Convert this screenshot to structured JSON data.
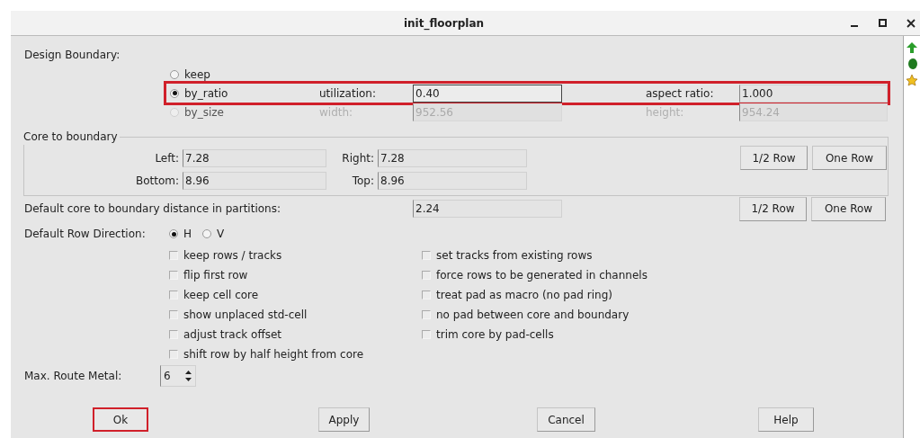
{
  "window": {
    "title": "init_floorplan"
  },
  "design_boundary": {
    "label": "Design Boundary:",
    "options": [
      {
        "label": "keep",
        "selected": false,
        "disabled": false,
        "highlighted": false
      },
      {
        "label": "by_ratio",
        "selected": true,
        "disabled": false,
        "highlighted": true,
        "fields": [
          {
            "label": "utilization:",
            "value": "0.40",
            "focused": true
          },
          {
            "label": "aspect ratio:",
            "value": "1.000",
            "focused": false
          }
        ]
      },
      {
        "label": "by_size",
        "selected": false,
        "disabled": true,
        "highlighted": false,
        "fields": [
          {
            "label": "width:",
            "value": "952.56",
            "focused": false
          },
          {
            "label": "height:",
            "value": "954.24",
            "focused": false
          }
        ]
      }
    ]
  },
  "core_to_boundary": {
    "title": "Core to boundary",
    "rows": [
      {
        "fields": [
          {
            "label": "Left:",
            "value": "7.28"
          },
          {
            "label": "Right:",
            "value": "7.28"
          }
        ],
        "buttons": [
          "1/2 Row",
          "One Row"
        ]
      },
      {
        "fields": [
          {
            "label": "Bottom:",
            "value": "8.96"
          },
          {
            "label": "Top:",
            "value": "8.96"
          }
        ]
      }
    ]
  },
  "partition_distance": {
    "label": "Default core to boundary distance in partitions:",
    "value": "2.24",
    "buttons": [
      "1/2 Row",
      "One Row"
    ]
  },
  "row_direction": {
    "label": "Default Row Direction:",
    "options": [
      {
        "label": "H",
        "selected": true
      },
      {
        "label": "V",
        "selected": false
      }
    ]
  },
  "options_left": [
    {
      "label": "keep rows / tracks",
      "checked": false
    },
    {
      "label": "flip first row",
      "checked": false
    },
    {
      "label": "keep cell core",
      "checked": false
    },
    {
      "label": "show unplaced std-cell",
      "checked": false
    },
    {
      "label": "adjust track offset",
      "checked": false
    },
    {
      "label": "shift row by half height from core",
      "checked": false
    }
  ],
  "options_right": [
    {
      "label": "set tracks from existing rows",
      "checked": false
    },
    {
      "label": "force rows to be generated in channels",
      "checked": false
    },
    {
      "label": "treat pad as macro (no pad ring)",
      "checked": false
    },
    {
      "label": "no pad between core and boundary",
      "checked": false
    },
    {
      "label": "trim core by pad-cells",
      "checked": false
    }
  ],
  "max_route_metal": {
    "label": "Max. Route Metal:",
    "value": "6"
  },
  "buttons": [
    {
      "label": "Ok",
      "highlighted": true
    },
    {
      "label": "Apply",
      "highlighted": false
    },
    {
      "label": "Cancel",
      "highlighted": false
    },
    {
      "label": "Help",
      "highlighted": false
    }
  ]
}
